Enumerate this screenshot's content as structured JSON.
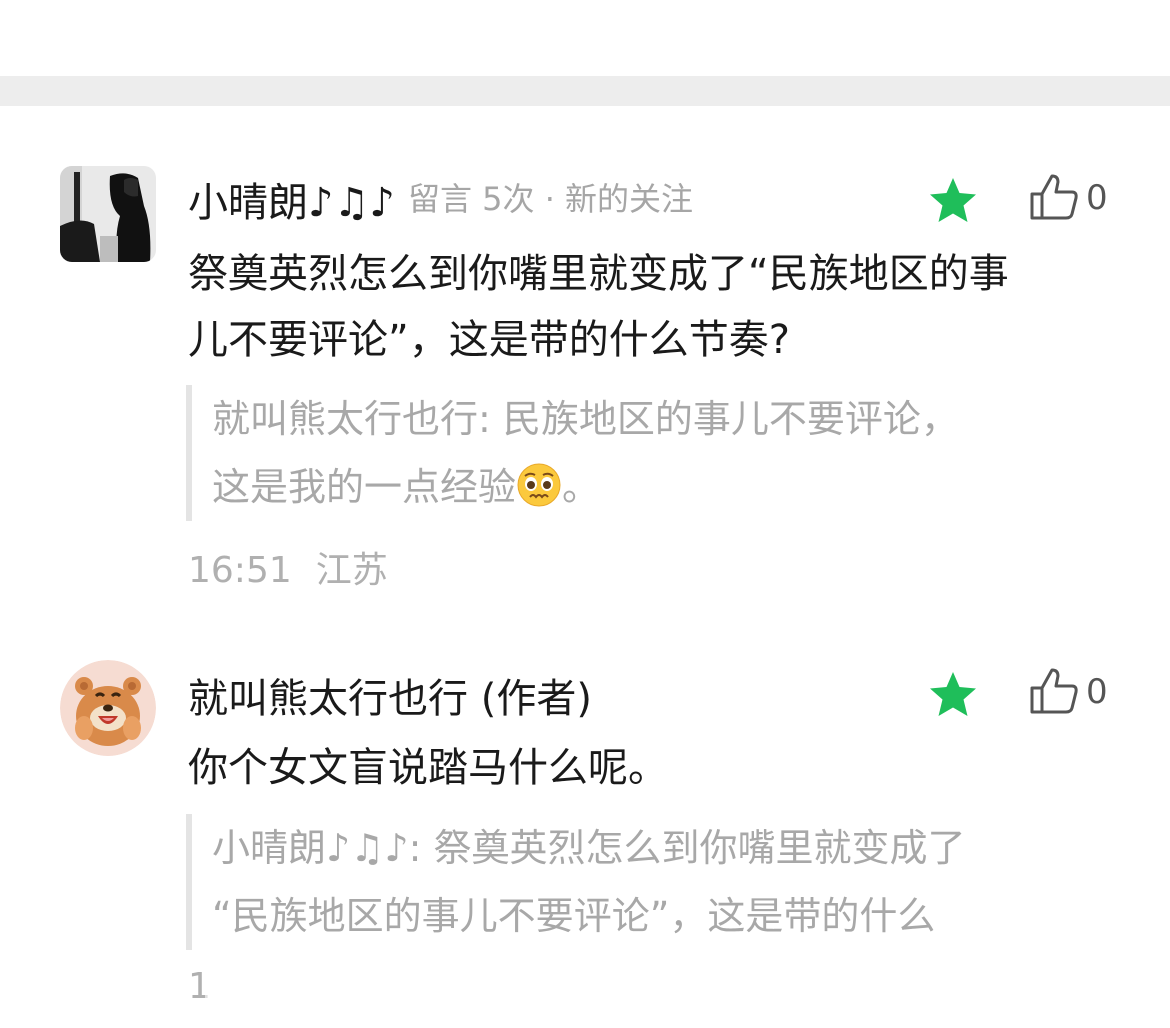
{
  "top_remnant": "— — — —",
  "comments": [
    {
      "author": "小晴朗♪♫♪",
      "meta": "留言 5次 · 新的关注",
      "like_count": "0",
      "body_lines": [
        "祭奠英烈怎么到你嘴里就变成了“民族地区的事",
        "儿不要评论”，这是带的什么节奏?"
      ],
      "quote_lines": [
        "就叫熊太行也行: 民族地区的事儿不要评论，",
        "这是我的一点经验"
      ],
      "quote_tail": "。",
      "quote_emoji": "pleading-face-emoji",
      "time": "16:51",
      "location": "江苏",
      "star_color": "#1fbe5a"
    },
    {
      "author": "就叫熊太行也行 (作者)",
      "like_count": "0",
      "body_lines": [
        "你个女文盲说踏马什么呢。"
      ],
      "quote_lines": [
        "小晴朗♪♫♪: 祭奠英烈怎么到你嘴里就变成了",
        "“民族地区的事儿不要评论”，这是带的什么"
      ],
      "time_partial": "1",
      "star_color": "#1fbe5a"
    }
  ]
}
